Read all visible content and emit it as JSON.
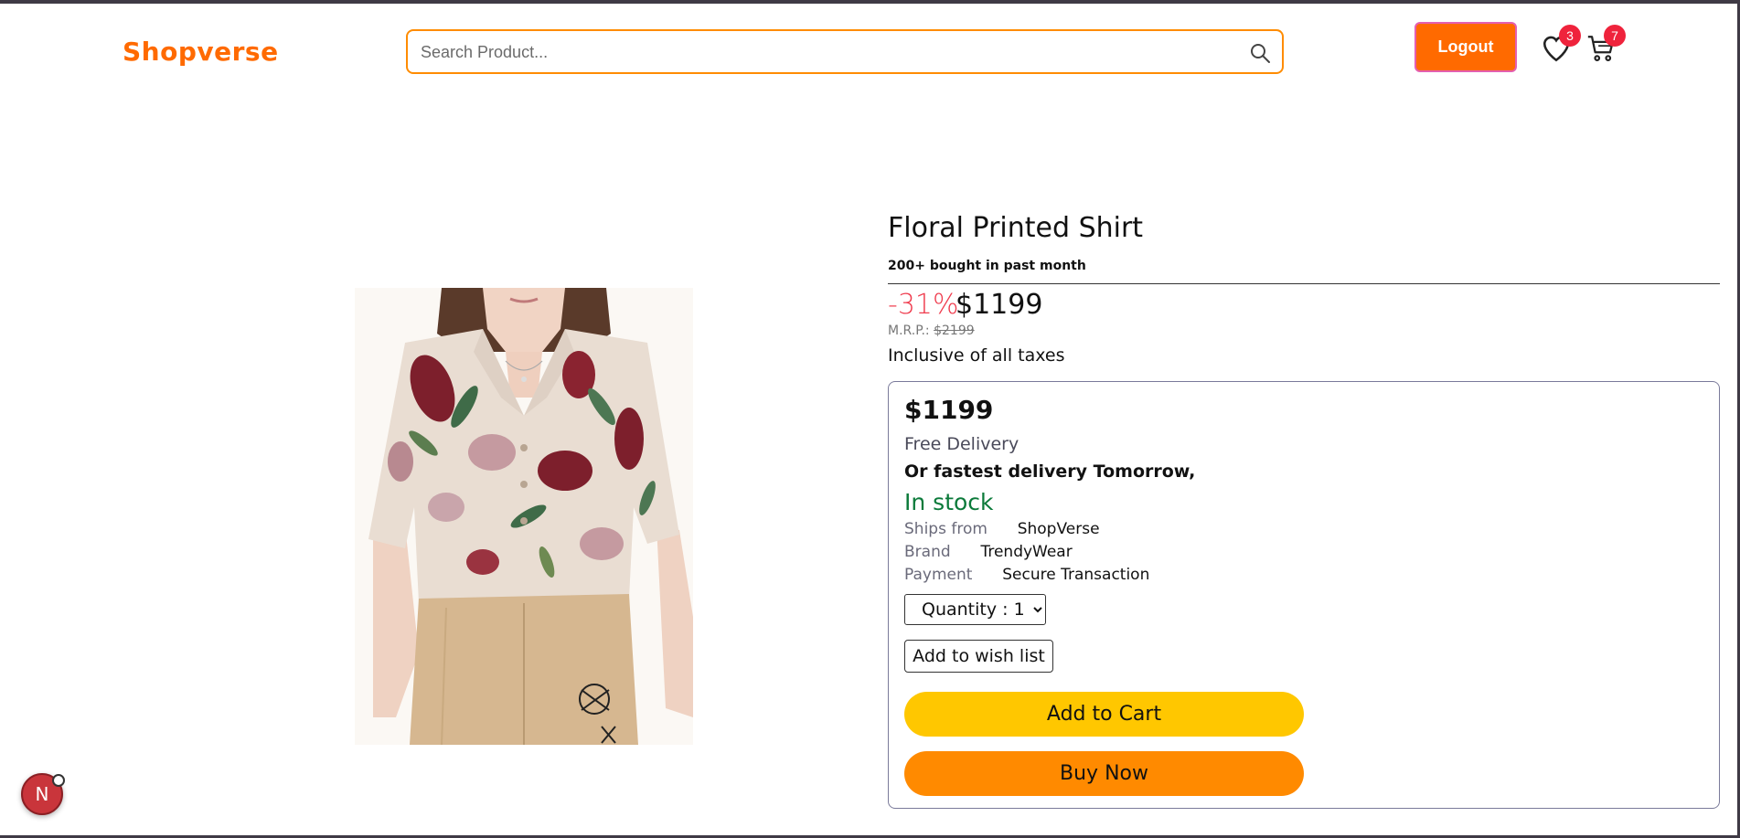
{
  "header": {
    "logo": "Shopverse",
    "search_placeholder": "Search Product...",
    "logout_label": "Logout",
    "wishlist_count": "3",
    "cart_count": "7",
    "icons": [
      "search-icon",
      "heart-icon",
      "cart-icon"
    ]
  },
  "product": {
    "title": "Floral Printed Shirt",
    "bought": "200+ bought in past month",
    "discount": "-31%",
    "price": "$1199",
    "mrp_label": "M.R.P.:",
    "mrp_value": "$2199",
    "taxes": "Inclusive of all taxes"
  },
  "buy_box": {
    "price": "$1199",
    "free_delivery": "Free Delivery",
    "fastest_delivery": "Or fastest delivery Tomorrow,",
    "stock_status": "In stock",
    "ships_from_label": "Ships from",
    "ships_from_value": "ShopVerse",
    "brand_label": "Brand",
    "brand_value": "TrendyWear",
    "payment_label": "Payment",
    "payment_value": "Secure Transaction",
    "quantity_option": "Quantity : 1",
    "wishlist_label": "Add to wish list",
    "add_to_cart_label": "Add to Cart",
    "buy_now_label": "Buy Now"
  },
  "dev_badge": {
    "letter": "N"
  },
  "colors": {
    "brand": "#ff6a00",
    "discount": "#ef3b4d",
    "in_stock": "#0b7a3a",
    "add_to_cart": "#ffc700",
    "buy_now": "#ff8a00",
    "badge": "#ef233c"
  }
}
